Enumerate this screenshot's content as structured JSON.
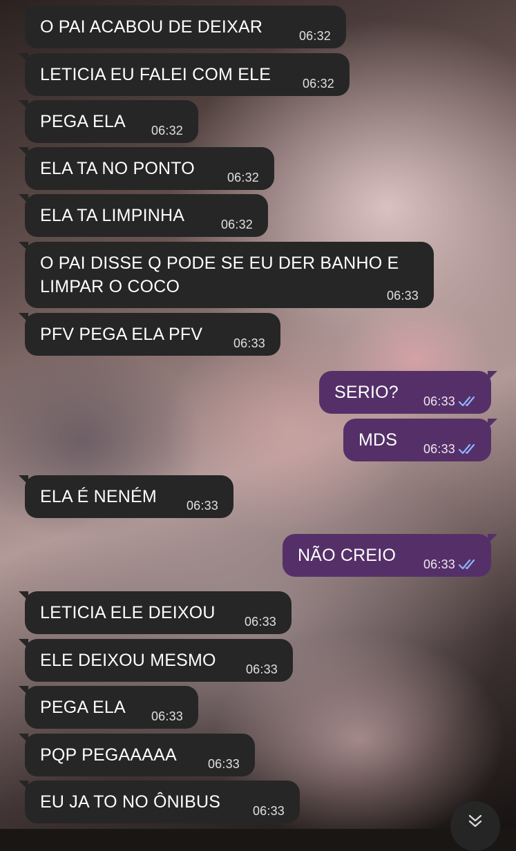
{
  "chat": {
    "messages": [
      {
        "id": 1,
        "direction": "in",
        "text": "O PAI ACABOU DE DEIXAR",
        "time": "06:32"
      },
      {
        "id": 2,
        "direction": "in",
        "text": "LETICIA EU FALEI COM ELE",
        "time": "06:32"
      },
      {
        "id": 3,
        "direction": "in",
        "text": "PEGA ELA",
        "time": "06:32"
      },
      {
        "id": 4,
        "direction": "in",
        "text": "ELA TA NO PONTO",
        "time": "06:32"
      },
      {
        "id": 5,
        "direction": "in",
        "text": "ELA TA LIMPINHA",
        "time": "06:32"
      },
      {
        "id": 6,
        "direction": "in",
        "text": "O PAI DISSE Q PODE SE EU DER BANHO E LIMPAR O COCO",
        "time": "06:33"
      },
      {
        "id": 7,
        "direction": "in",
        "text": "PFV PEGA ELA PFV",
        "time": "06:33"
      },
      {
        "id": 8,
        "direction": "out",
        "text": "SERIO?",
        "time": "06:33",
        "status": "read"
      },
      {
        "id": 9,
        "direction": "out",
        "text": "MDS",
        "time": "06:33",
        "status": "read"
      },
      {
        "id": 10,
        "direction": "in",
        "text": "ELA É NENÉM",
        "time": "06:33"
      },
      {
        "id": 11,
        "direction": "out",
        "text": "NÃO CREIO",
        "time": "06:33",
        "status": "read"
      },
      {
        "id": 12,
        "direction": "in",
        "text": "LETICIA ELE DEIXOU",
        "time": "06:33"
      },
      {
        "id": 13,
        "direction": "in",
        "text": "ELE DEIXOU MESMO",
        "time": "06:33"
      },
      {
        "id": 14,
        "direction": "in",
        "text": "PEGA ELA",
        "time": "06:33"
      },
      {
        "id": 15,
        "direction": "in",
        "text": "PQP PEGAAAAA",
        "time": "06:33"
      },
      {
        "id": 16,
        "direction": "in",
        "text": "EU JA TO NO ÔNIBUS",
        "time": "06:33"
      }
    ]
  },
  "icons": {
    "read_receipt": "double-check-icon",
    "scroll_down": "double-chevron-down-icon"
  },
  "colors": {
    "incoming_bubble": "#262626",
    "outgoing_bubble": "#553068",
    "read_ticks": "#8fb4ff"
  }
}
